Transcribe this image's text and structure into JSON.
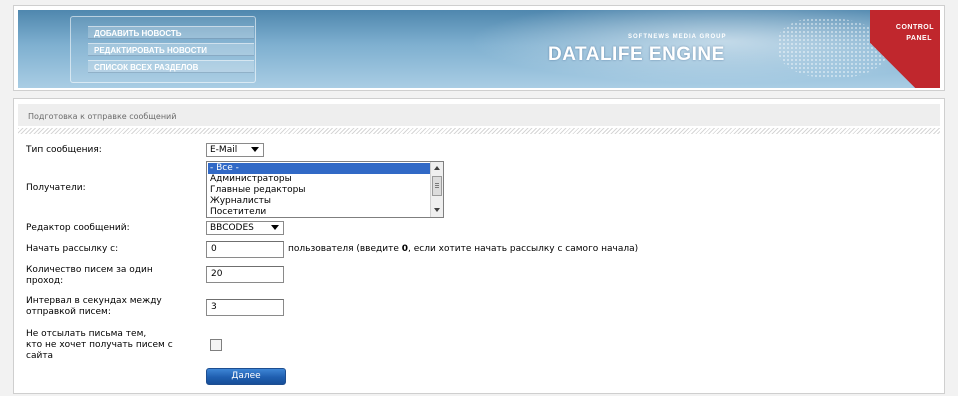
{
  "header": {
    "nav": [
      {
        "label": "ДОБАВИТЬ НОВОСТЬ"
      },
      {
        "label": "РЕДАКТИРОВАТЬ НОВОСТИ"
      },
      {
        "label": "СПИСОК ВСЕХ РАЗДЕЛОВ"
      }
    ],
    "brand_small": "SOFTNEWS MEDIA GROUP",
    "brand_big": "DATALIFE ENGINE",
    "corner_line1": "CONTROL",
    "corner_line2": "PANEL",
    "corner_color": "#c0272d"
  },
  "panel": {
    "title": "Подготовка к отправке сообщений"
  },
  "form": {
    "message_type_label": "Тип сообщения:",
    "message_type_value": "E-Mail",
    "recipients_label": "Получатели:",
    "recipients_options": [
      "- Все -",
      "Администраторы",
      "Главные редакторы",
      "Журналисты",
      "Посетители"
    ],
    "editor_label": "Редактор сообщений:",
    "editor_value": "BBCODES",
    "start_label": "Начать рассылку с:",
    "start_value": "0",
    "start_hint_prefix": "пользователя (введите ",
    "start_hint_bold": "0",
    "start_hint_suffix": ", если хотите начать рассылку с самого начала)",
    "count_label_line1": "Количество писем за один",
    "count_label_line2": "проход:",
    "count_value": "20",
    "interval_label_line1": "Интервал в секундах между",
    "interval_label_line2": "отправкой писем:",
    "interval_value": "3",
    "optout_label_line1": "Не отсылать письма тем,",
    "optout_label_line2": "кто не хочет получать писем с",
    "optout_label_line3": "сайта",
    "optout_checked": false,
    "submit_label": "Далее"
  }
}
